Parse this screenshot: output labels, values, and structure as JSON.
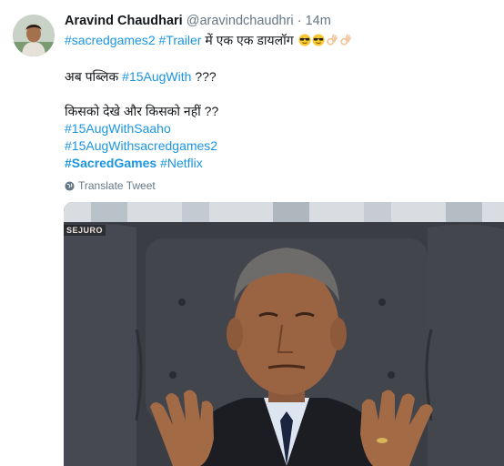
{
  "tweet": {
    "author_name": "Aravind Chaudhari",
    "author_handle": "@aravindchaudhri",
    "separator": "·",
    "time": "14m",
    "line1_parts": [
      "#sacredgames2",
      " ",
      "#Trailer",
      " में एक एक डायलॉग "
    ],
    "line2_parts": [
      "अब पब्लिक ",
      "#15AugWith",
      " ???"
    ],
    "line3": "किसको देखे और किसको नहीं ??",
    "hashtag_saaho": "#15AugWithSaaho",
    "hashtag_sacredgames2": "#15AugWithsacredgames2",
    "hashtag_sacredgames": "#SacredGames",
    "hashtag_netflix": "#Netflix",
    "translate_label": "Translate Tweet",
    "emojis": [
      "sunglasses-emoji",
      "sunglasses-emoji",
      "ok-hand-emoji",
      "ok-hand-emoji"
    ],
    "media_watermark": "SEJURO"
  },
  "colors": {
    "link": "#1b95e0",
    "muted": "#657786",
    "text": "#14171a"
  }
}
